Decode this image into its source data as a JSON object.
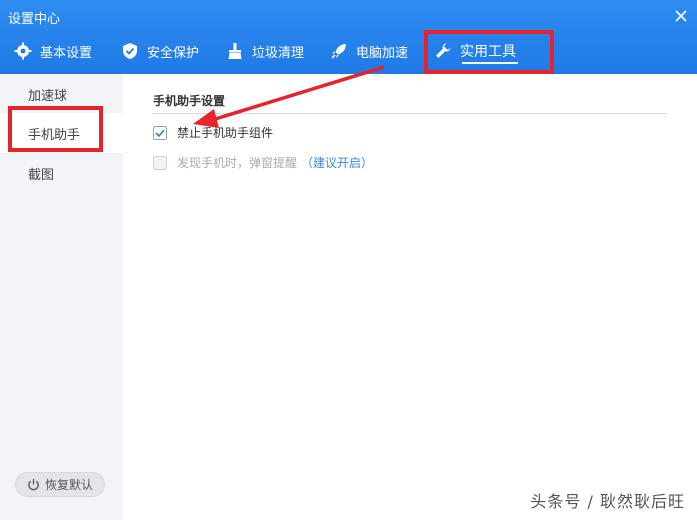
{
  "window": {
    "title": "设置中心"
  },
  "tabs": [
    {
      "label": "基本设置",
      "icon": "gear-icon"
    },
    {
      "label": "安全保护",
      "icon": "shield-icon"
    },
    {
      "label": "垃圾清理",
      "icon": "broom-icon"
    },
    {
      "label": "电脑加速",
      "icon": "rocket-icon"
    },
    {
      "label": "实用工具",
      "icon": "wrench-icon",
      "active": true
    }
  ],
  "sidebar": {
    "items": [
      {
        "label": "加速球"
      },
      {
        "label": "手机助手",
        "active": true
      },
      {
        "label": "截图"
      }
    ],
    "restore_label": "恢复默认"
  },
  "content": {
    "section_title": "手机助手设置",
    "option1": {
      "label": "禁止手机助手组件",
      "checked": true
    },
    "option2": {
      "label": "发现手机时，弹窗提醒",
      "link": "（建议开启）",
      "checked": false,
      "disabled": true
    }
  },
  "watermark": "头条号 / 耿然耿后旺",
  "colors": {
    "header": "#1f7ae6",
    "highlight": "#e5242b",
    "link": "#3a89d8"
  }
}
